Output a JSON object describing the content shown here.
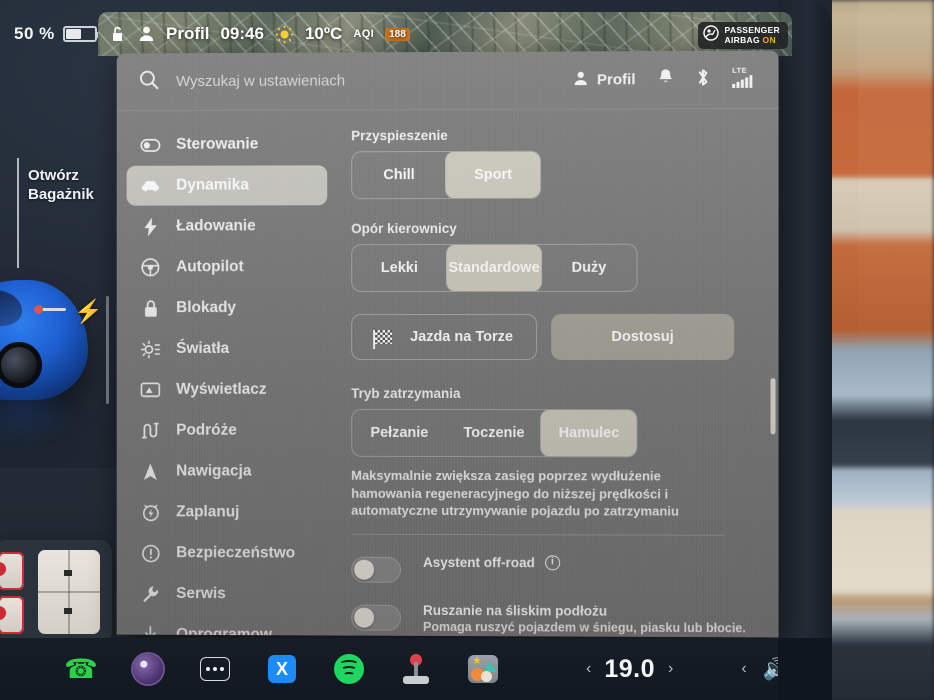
{
  "left_overlay": {
    "battery_percent": "50 %",
    "battery_level": 50,
    "trunk_action": "Otwórz\nBagażnik",
    "trunk_action_line1": "Otwórz",
    "trunk_action_line2": "Bagażnik",
    "charge_icon": "lightning-bolt-icon"
  },
  "status_bar": {
    "lock_icon": "unlock-icon",
    "profile_icon": "person-icon",
    "profile": "Profil",
    "time": "09:46",
    "weather_icon": "sun-icon",
    "temperature": "10ºC",
    "aqi_label": "AQI",
    "aqi_value": "188",
    "airbag_icon": "passenger-airbag-icon",
    "airbag_line1": "PASSENGER",
    "airbag_line2": "AIRBAG",
    "airbag_state": "ON"
  },
  "header": {
    "search_icon": "search-icon",
    "search_value": "",
    "search_placeholder": "Wyszukaj w ustawieniach",
    "profile_icon": "person-icon",
    "profile_label": "Profil",
    "bell_icon": "bell-icon",
    "bluetooth_icon": "bluetooth-icon",
    "network_label": "LTE",
    "signal_icon": "signal-bars-icon"
  },
  "sidebar": {
    "items": [
      {
        "label": "Sterowanie",
        "icon": "toggle-switch-icon",
        "active": false
      },
      {
        "label": "Dynamika",
        "icon": "car-icon",
        "active": true
      },
      {
        "label": "Ładowanie",
        "icon": "lightning-bolt-icon",
        "active": false
      },
      {
        "label": "Autopilot",
        "icon": "steering-wheel-icon",
        "active": false
      },
      {
        "label": "Blokady",
        "icon": "lock-icon",
        "active": false
      },
      {
        "label": "Światła",
        "icon": "headlight-icon",
        "active": false
      },
      {
        "label": "Wyświetlacz",
        "icon": "display-icon",
        "active": false
      },
      {
        "label": "Podróże",
        "icon": "road-icon",
        "active": false
      },
      {
        "label": "Nawigacja",
        "icon": "navigation-arrow-icon",
        "active": false
      },
      {
        "label": "Zaplanuj",
        "icon": "clock-bolt-icon",
        "active": false
      },
      {
        "label": "Bezpieczeństwo",
        "icon": "exclamation-circle-icon",
        "active": false
      },
      {
        "label": "Serwis",
        "icon": "wrench-icon",
        "active": false
      },
      {
        "label": "Oprogramow.",
        "icon": "download-icon",
        "active": false
      }
    ]
  },
  "content": {
    "acceleration": {
      "title": "Przyspieszenie",
      "options": [
        "Chill",
        "Sport"
      ],
      "selected": "Sport"
    },
    "steering": {
      "title": "Opór kierownicy",
      "options": [
        "Lekki",
        "Standardowe",
        "Duży"
      ],
      "selected": "Standardowe"
    },
    "track": {
      "icon": "checkered-flag-icon",
      "button_label": "Jazda na Torze",
      "customize_label": "Dostosuj"
    },
    "stopping_mode": {
      "title": "Tryb zatrzymania",
      "options": [
        "Pełzanie",
        "Toczenie",
        "Hamulec"
      ],
      "selected": "Hamulec",
      "description": "Maksymalnie zwiększa zasięg poprzez wydłużenie hamowania regeneracyjnego do niższej prędkości i automatyczne utrzymywanie pojazdu po zatrzymaniu"
    },
    "toggles": [
      {
        "label": "Asystent off-road",
        "sub": "",
        "info_icon": "info-circle-icon",
        "on": false
      },
      {
        "label": "Ruszanie na śliskim podłożu",
        "sub": "Pomaga ruszyć pojazdem w śniegu, piasku lub błocie.",
        "info_icon": "",
        "on": false
      }
    ]
  },
  "taskbar": {
    "apps": [
      {
        "name": "phone-app-icon",
        "label": "Telefon"
      },
      {
        "name": "camera-app-icon",
        "label": "Kamera"
      },
      {
        "name": "more-apps-icon",
        "label": "Więcej"
      },
      {
        "name": "bluetooth-app-icon",
        "label": "Bluetooth"
      },
      {
        "name": "spotify-app-icon",
        "label": "Spotify"
      },
      {
        "name": "arcade-app-icon",
        "label": "Arcade"
      },
      {
        "name": "gallery-app-icon",
        "label": "Galeria"
      }
    ],
    "climate": {
      "decrease_icon": "chevron-left-icon",
      "temperature": "19.0",
      "increase_icon": "chevron-right-icon"
    },
    "volume": {
      "decrease_icon": "chevron-left-icon",
      "speaker_icon": "volume-icon",
      "increase_icon": "chevron-right-icon"
    }
  },
  "colors": {
    "panel_bg": "#7c7c7c",
    "selected_segment": "#cfccc0",
    "sidebar_active": "rgba(232,230,222,0.72)",
    "accent_orange": "#c8751f",
    "airbag_on": "#f2a63a",
    "spotify_green": "#1ed760",
    "bluetooth_blue": "#1d8bf4",
    "phone_green": "#2ad14a"
  }
}
